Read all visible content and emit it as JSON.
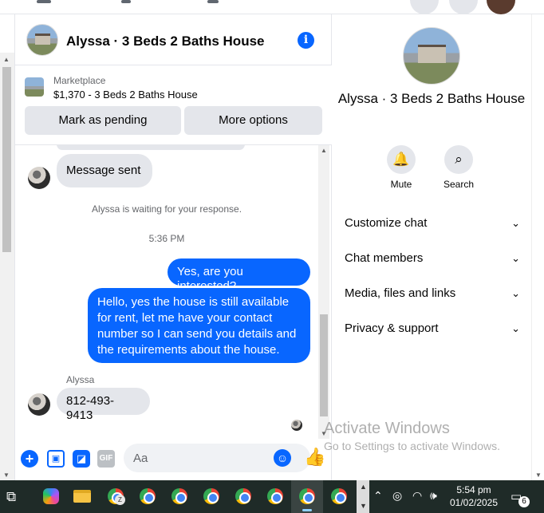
{
  "chat": {
    "title": "Alyssa · 3 Beds 2 Baths House",
    "listing": {
      "source": "Marketplace",
      "price_title": "$1,370 - 3 Beds 2 Baths House",
      "mark_pending_label": "Mark as pending",
      "more_options_label": "More options"
    },
    "messages": {
      "sent_notice": "Message sent",
      "waiting": "Alyssa is waiting for your response.",
      "timestamp": "5:36 PM",
      "out1": "Yes, are you interested?",
      "out2": "Hello, yes the house is still available for rent, let me have your contact number so I can send you details and the requirements about the house.",
      "sender_name": "Alyssa",
      "in_phone": "812-493-9413"
    },
    "composer": {
      "placeholder": "Aa",
      "gif_label": "GIF"
    }
  },
  "details": {
    "title": "Alyssa · 3 Beds 2 Baths House",
    "actions": [
      {
        "label": "Mute",
        "icon": "bell-icon"
      },
      {
        "label": "Search",
        "icon": "search-icon"
      }
    ],
    "sections": [
      {
        "label": "Customize chat"
      },
      {
        "label": "Chat members"
      },
      {
        "label": "Media, files and links"
      },
      {
        "label": "Privacy & support"
      }
    ]
  },
  "watermark": {
    "line1": "Activate Windows",
    "line2": "Go to Settings to activate Windows."
  },
  "taskbar": {
    "time": "5:54 pm",
    "date": "01/02/2025",
    "notification_count": "6",
    "profile_badge": "Z"
  },
  "colors": {
    "accent": "#0866ff",
    "bubble_in": "#e4e6eb",
    "taskbar": "#1f2b28"
  }
}
